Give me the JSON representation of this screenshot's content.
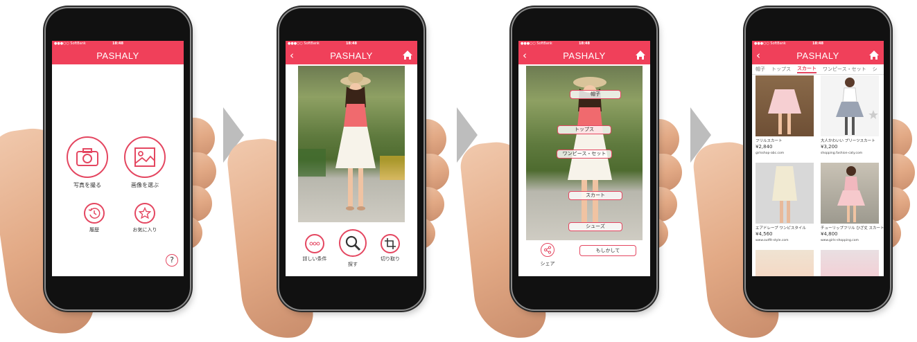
{
  "app": {
    "title": "PASHALY",
    "carrier": "●●●○○ SoftBank",
    "time": "18:48"
  },
  "screen1": {
    "take_photo": "写真を撮る",
    "choose_image": "画像を選ぶ",
    "history": "履歴",
    "favorites": "お気に入り",
    "help": "?"
  },
  "screen2": {
    "detailed_conditions": "詳しい条件",
    "search": "探す",
    "crop": "切り取り"
  },
  "screen3": {
    "tags": [
      "帽子",
      "トップス",
      "ワンピース・セット",
      "スカート",
      "シューズ"
    ],
    "share": "シェア",
    "maybe": "もしかして"
  },
  "screen4": {
    "tabs": [
      "帽子",
      "トップス",
      "スカート",
      "ワンピース・セット",
      "シ"
    ],
    "products": [
      {
        "name": "フリルスカート",
        "price": "¥2,840",
        "shop": "girlsshop-abc.com"
      },
      {
        "name": "大人かわいい プリーツスカート",
        "price": "¥3,200",
        "shop": "shopping.fashion-caty.com"
      },
      {
        "name": "エアドレープ ワンピスタイル",
        "price": "¥4,560",
        "shop": "www.outfit-style.com"
      },
      {
        "name": "チューリップフリル ひざ丈 スカート",
        "price": "¥4,800",
        "shop": "www.girls-shopping.com"
      }
    ]
  },
  "colors": {
    "accent": "#f0405a",
    "separator": "#bdbdbd"
  }
}
